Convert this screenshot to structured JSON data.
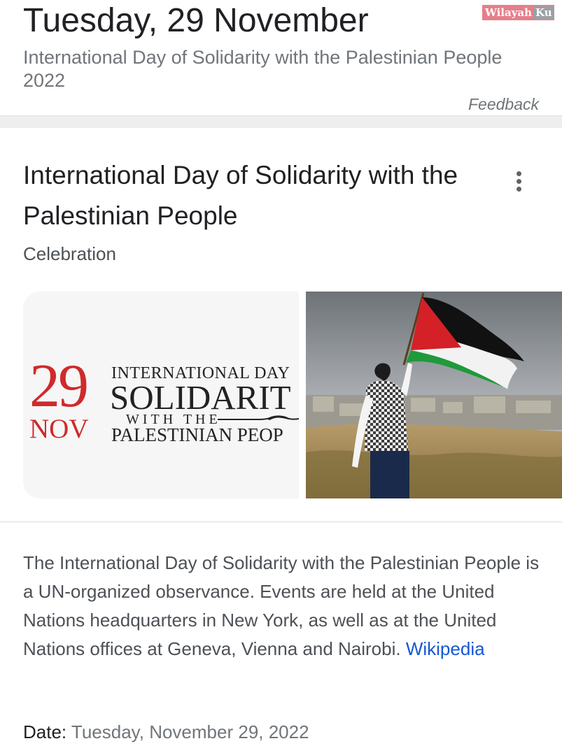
{
  "header": {
    "date_heading": "Tuesday, 29 November",
    "observance": "International Day of Solidarity with the Palestinian People 2022",
    "feedback_label": "Feedback"
  },
  "watermark": {
    "part_a": "Wilayah",
    "part_b": "Ku"
  },
  "card": {
    "title": "International Day of Solidarity with the Palestinian People",
    "subtitle": "Celebration",
    "more_icon": "more-vert-icon",
    "images": {
      "poster": {
        "day": "29",
        "month": "NOV",
        "line1": "INTERNATIONAL DAY",
        "line2": "SOLIDARIT",
        "line3": "WITH THE",
        "line4": "PALESTINIAN PEOP"
      }
    },
    "description": "The International Day of Solidarity with the Palestinian People is a UN-organized observance. Events are held at the United Nations headquarters in New York, as well as at the United Nations offices at Geneva, Vienna and Nairobi.",
    "source_link": "Wikipedia",
    "date_label": "Date:",
    "date_value": "Tuesday, November 29, 2022"
  },
  "colors": {
    "poster_red": "#cf2a2c",
    "link_blue": "#1558d6",
    "flag_red": "#d42027",
    "flag_green": "#1f9a3a",
    "flag_black": "#111111"
  }
}
